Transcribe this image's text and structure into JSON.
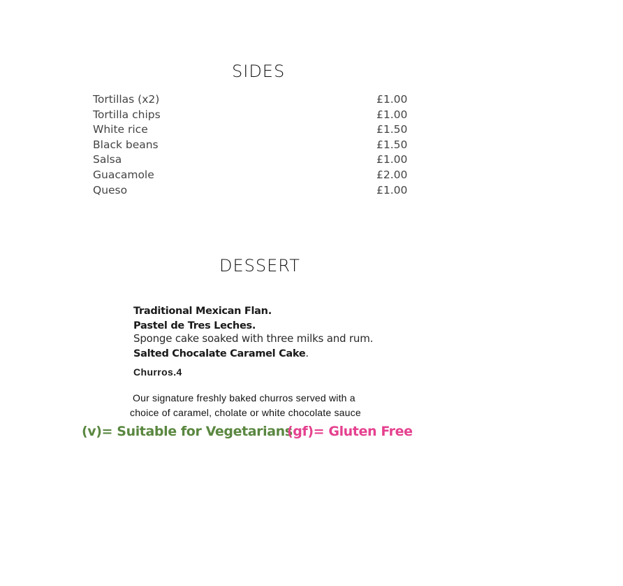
{
  "sides": {
    "title": "SIDES",
    "items": [
      {
        "name": "Tortillas (x2)",
        "price": "£1.00"
      },
      {
        "name": "Tortilla chips",
        "price": "£1.00"
      },
      {
        "name": "White rice",
        "price": "£1.50"
      },
      {
        "name": "Black beans",
        "price": "£1.50"
      },
      {
        "name": "Salsa",
        "price": "£1.00"
      },
      {
        "name": "Guacamole",
        "price": "£2.00"
      },
      {
        "name": "Queso",
        "price": "£1.00"
      }
    ]
  },
  "dessert": {
    "title": "DESSERT",
    "flan": "Traditional Mexican Flan.",
    "tres_leches": "Pastel de Tres Leches.",
    "tres_leches_desc": "Sponge cake soaked with three milks and rum.",
    "caramel_cake": "Salted Chocalate Caramel Cake",
    "caramel_cake_period": ".",
    "churros": "Churros.4",
    "churros_desc_line1": "Our signature freshly baked churros served with a",
    "churros_desc_line2": "choice of caramel, cholate or white chocolate sauce"
  },
  "legend": {
    "vegetarian": "(v)= Suitable for Vegetarians",
    "gluten_free": "(gf)= Gluten Free"
  },
  "colors": {
    "vegetarian": "#5a8740",
    "gluten_free": "#e5418f"
  }
}
